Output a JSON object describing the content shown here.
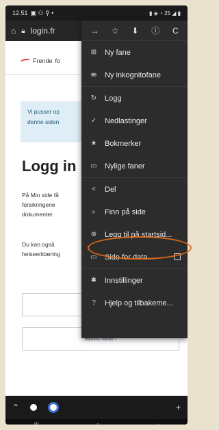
{
  "status": {
    "time": "12.51",
    "left_icons": "▣ ⚇ ⚲ •",
    "right_icons": "▮ ◈ ◔ 25 ◢ ▮"
  },
  "urlbar": {
    "home_icon": "home-icon",
    "url": "login.fr"
  },
  "page": {
    "logo_text": "Frende",
    "logo_suffix": "fo",
    "notice": [
      "Vi pusser op",
      "denne siden"
    ],
    "heading": "Logg in",
    "body1": [
      "På Min side få",
      "forsikringene",
      "dokumenter."
    ],
    "body2": [
      "Du kan også",
      "helseerklæring"
    ],
    "bankid_label": "BankID Mobil ›"
  },
  "menu": {
    "top_icons": [
      "→",
      "☆",
      "⬇",
      "ⓘ",
      "C"
    ],
    "items": [
      {
        "icon": "⊞",
        "label": "Ny fane"
      },
      {
        "icon": "⛂",
        "label": "Ny inkognitofane"
      },
      {
        "icon": "↻",
        "label": "Logg"
      },
      {
        "icon": "✓",
        "label": "Nedlastinger"
      },
      {
        "icon": "★",
        "label": "Bokmerker"
      },
      {
        "icon": "▭",
        "label": "Nylige faner"
      },
      {
        "icon": "<",
        "label": "Del"
      },
      {
        "icon": "⌕",
        "label": "Finn på side"
      },
      {
        "icon": "⊕",
        "label": "Legg til på startsid..."
      },
      {
        "icon": "▭",
        "label": "Side for data..."
      },
      {
        "icon": "✱",
        "label": "Innstillinger"
      },
      {
        "icon": "?",
        "label": "Hjelp og tilbakeme..."
      }
    ]
  },
  "bottom": {
    "back": "‹",
    "plus": "+"
  },
  "nav": {
    "recents": "|||",
    "home": "○",
    "back": "‹"
  },
  "colors": {
    "highlight": "#e06a1a",
    "menu_bg": "#2c2c2c",
    "notice_bg": "#dfeef6"
  }
}
